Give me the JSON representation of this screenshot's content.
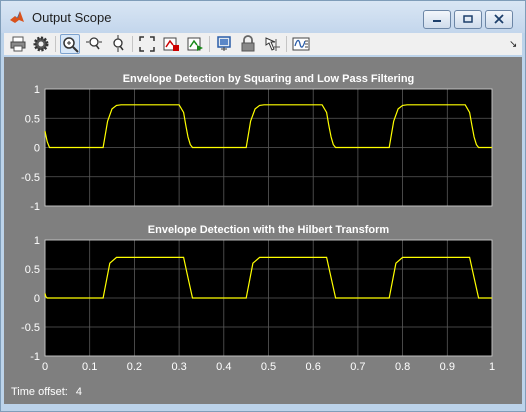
{
  "window": {
    "title": "Output Scope"
  },
  "toolbar": {
    "items": [
      {
        "icon": "print-icon"
      },
      {
        "icon": "settings-gear-icon"
      },
      {
        "icon": "zoom-in-icon"
      },
      {
        "icon": "zoom-x-icon"
      },
      {
        "icon": "zoom-y-icon"
      },
      {
        "icon": "scale-axes-icon"
      },
      {
        "icon": "simulation-pause-icon"
      },
      {
        "icon": "step-forward-icon"
      },
      {
        "icon": "highlight-simulink-block-icon"
      },
      {
        "icon": "lock-icon"
      },
      {
        "icon": "cursor-measurements-icon"
      },
      {
        "icon": "legend-signal-icon"
      }
    ],
    "dock_glyph": "↘"
  },
  "status": {
    "time_offset_label": "Time offset:",
    "time_offset_value": "4"
  },
  "chart_data": [
    {
      "type": "line",
      "title": "Envelope Detection by Squaring and Low Pass Filtering",
      "xlim": [
        0,
        1
      ],
      "ylim": [
        -1,
        1
      ],
      "xticks": [
        0,
        0.1,
        0.2,
        0.3,
        0.4,
        0.5,
        0.6,
        0.7,
        0.8,
        0.9,
        1
      ],
      "yticks": [
        1,
        0.5,
        0,
        -0.5,
        -1
      ],
      "grid": true,
      "background": "#000000",
      "series": [
        {
          "color": "#ffff00",
          "x": [
            0,
            0.005,
            0.01,
            0.13,
            0.14,
            0.15,
            0.16,
            0.17,
            0.3,
            0.31,
            0.315,
            0.32,
            0.325,
            0.33,
            0.45,
            0.46,
            0.47,
            0.48,
            0.49,
            0.62,
            0.63,
            0.635,
            0.64,
            0.645,
            0.65,
            0.77,
            0.78,
            0.79,
            0.8,
            0.81,
            0.94,
            0.95,
            0.955,
            0.96,
            0.965,
            0.97,
            1.0
          ],
          "y": [
            0.28,
            0.1,
            0,
            0,
            0.45,
            0.66,
            0.72,
            0.73,
            0.73,
            0.6,
            0.38,
            0.18,
            0.05,
            0,
            0,
            0.45,
            0.66,
            0.72,
            0.73,
            0.73,
            0.6,
            0.38,
            0.18,
            0.05,
            0,
            0,
            0.45,
            0.66,
            0.72,
            0.73,
            0.73,
            0.6,
            0.38,
            0.18,
            0.05,
            0,
            0
          ]
        }
      ]
    },
    {
      "type": "line",
      "title": "Envelope Detection with the Hilbert Transform",
      "xlim": [
        0,
        1
      ],
      "ylim": [
        -1,
        1
      ],
      "xticks": [
        0,
        0.1,
        0.2,
        0.3,
        0.4,
        0.5,
        0.6,
        0.7,
        0.8,
        0.9,
        1
      ],
      "yticks": [
        1,
        0.5,
        0,
        -0.5,
        -1
      ],
      "grid": true,
      "background": "#000000",
      "series": [
        {
          "color": "#ffff00",
          "x": [
            0,
            0.002,
            0.005,
            0.13,
            0.145,
            0.16,
            0.31,
            0.32,
            0.33,
            0.45,
            0.465,
            0.48,
            0.63,
            0.64,
            0.65,
            0.77,
            0.785,
            0.8,
            0.95,
            0.96,
            0.97,
            1.0
          ],
          "y": [
            0.08,
            0.02,
            0,
            0,
            0.6,
            0.7,
            0.7,
            0.35,
            0,
            0,
            0.6,
            0.7,
            0.7,
            0.35,
            0,
            0,
            0.6,
            0.7,
            0.7,
            0.35,
            0,
            0
          ]
        }
      ]
    }
  ]
}
